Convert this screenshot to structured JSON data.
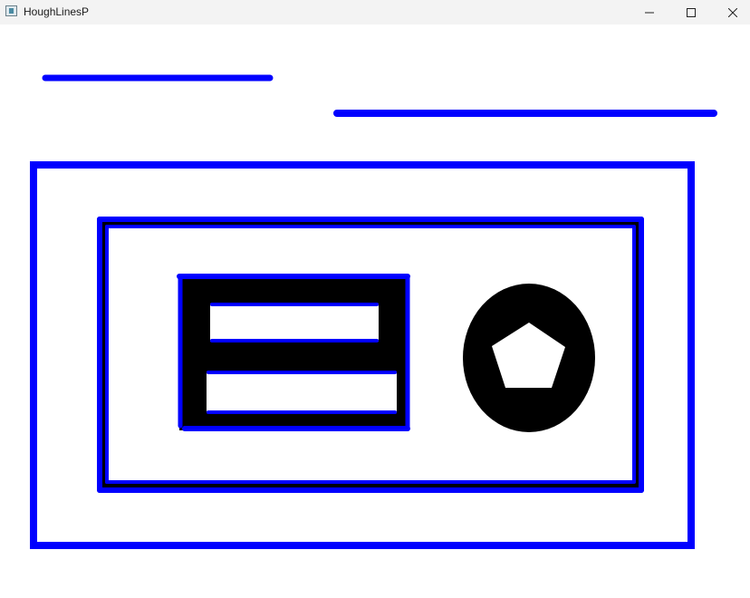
{
  "window": {
    "title": "HoughLinesP",
    "app_icon": "opencv-window-icon",
    "controls": [
      "minimize-icon",
      "maximize-icon",
      "close-icon"
    ]
  },
  "colors": {
    "detected_line": "#0000ff",
    "shape_fill": "#000000",
    "background": "#ffffff",
    "titlebar": "#f3f3f3"
  }
}
